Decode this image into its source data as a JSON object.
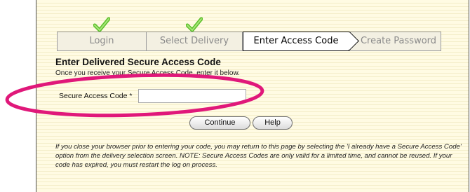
{
  "steps": [
    {
      "label": "Login",
      "completed": true
    },
    {
      "label": "Select Delivery",
      "completed": true
    },
    {
      "label": "Enter Access Code",
      "active": true
    },
    {
      "label": "Create Password"
    }
  ],
  "form": {
    "title": "Enter Delivered Secure Access Code",
    "subtitle": "Once you receive your Secure Access Code, enter it below.",
    "field_label": "Secure Access Code *",
    "field_value": ""
  },
  "buttons": {
    "continue_label": "Continue",
    "help_label": "Help"
  },
  "note": "If you close your browser prior to entering your code, you may return to this page by selecting the 'I already have a Secure Access Code' option from the delivery selection screen. NOTE: Secure Access Codes are only valid for a limited time, and cannot be reused. If your code has expired, you must restart the log on process.",
  "colors": {
    "highlight": "#e0187a",
    "checkmark": "#5cc02a",
    "panel_background": "#fffbe3"
  }
}
